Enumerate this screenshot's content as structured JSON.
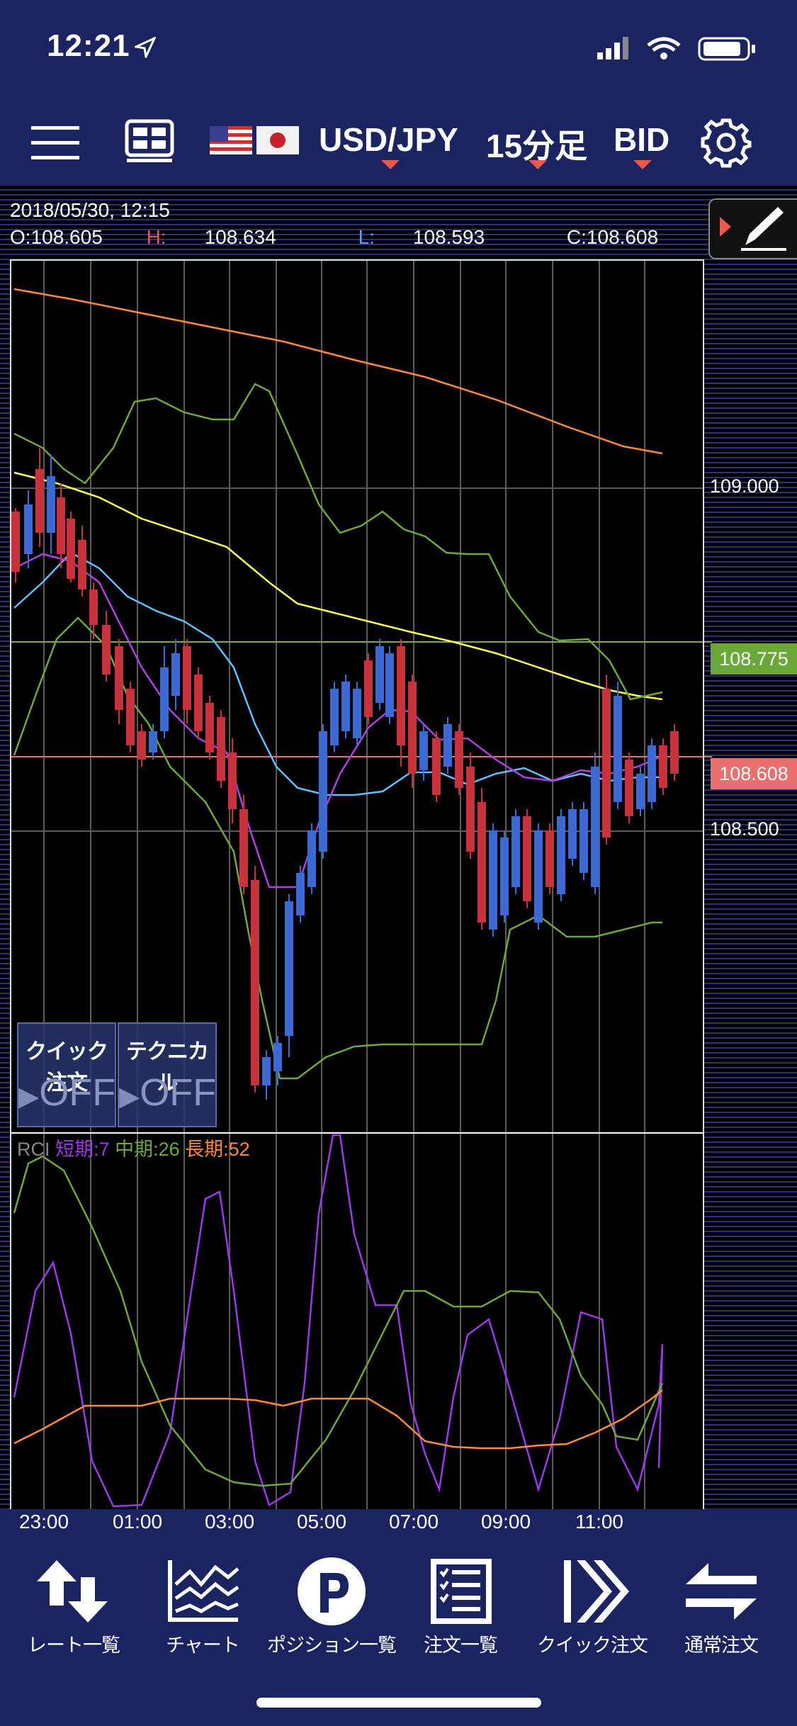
{
  "status": {
    "time": "12:21"
  },
  "header": {
    "symbol": "USD/JPY",
    "timeframe": "15分足",
    "price_type": "BID"
  },
  "info": {
    "datetime": "2018/05/30, 12:15",
    "open": "O:108.605",
    "high_prefix": "H:",
    "high_value": "108.634",
    "low_prefix": "L:",
    "low_value": "108.593",
    "close": "C:108.608"
  },
  "prices": {
    "gridline_top": "109.000",
    "green_tag": "108.775",
    "red_tag": "108.608",
    "gridline_bottom": "108.500"
  },
  "overlays": {
    "quick_order_label": "クイック注文",
    "quick_order_state": "OFF",
    "technical_label": "テクニカル",
    "technical_state": "OFF"
  },
  "rci": {
    "title": "RCI",
    "short": "短期:7",
    "mid": "中期:26",
    "long": "長期:52"
  },
  "time_axis": [
    "23:00",
    "01:00",
    "03:00",
    "05:00",
    "07:00",
    "09:00",
    "11:00"
  ],
  "tabs": [
    {
      "label": "レート一覧",
      "icon": "arrows-up-down-icon"
    },
    {
      "label": "チャート",
      "icon": "chart-icon"
    },
    {
      "label": "ポジション一覧",
      "icon": "position-p-icon"
    },
    {
      "label": "注文一覧",
      "icon": "order-list-icon"
    },
    {
      "label": "クイック注文",
      "icon": "quick-order-icon"
    },
    {
      "label": "通常注文",
      "icon": "normal-order-icon"
    }
  ],
  "colors": {
    "accent_red": "#e8584c",
    "green_tag": "#6aa838",
    "red_tag": "#e87070",
    "candle_up": "#c8323a",
    "candle_down": "#3c6ad2",
    "navy": "#1b2360"
  }
}
